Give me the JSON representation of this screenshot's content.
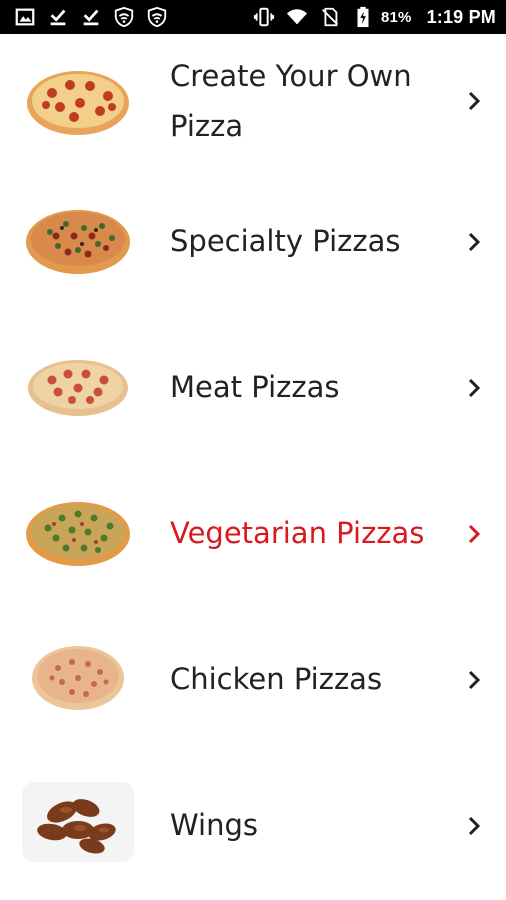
{
  "status_bar": {
    "left_icons": [
      "image-icon",
      "download-done-icon",
      "download-done-icon",
      "shield-wifi-icon",
      "shield-wifi-icon"
    ],
    "right_icons": [
      "vibrate-icon",
      "wifi-icon",
      "no-sim-icon",
      "battery-charging-icon"
    ],
    "battery": "81%",
    "time": "1:19 PM"
  },
  "menu": {
    "active_color": "#d71920",
    "text_color": "#222222",
    "items": [
      {
        "label": "Create Your Own Pizza",
        "image": "pepperoni-pizza-image",
        "active": false
      },
      {
        "label": "Specialty Pizzas",
        "image": "supreme-pizza-image",
        "active": false
      },
      {
        "label": "Meat Pizzas",
        "image": "meat-pizza-image",
        "active": false
      },
      {
        "label": "Vegetarian Pizzas",
        "image": "vegetarian-pizza-image",
        "active": true
      },
      {
        "label": "Chicken Pizzas",
        "image": "chicken-pizza-image",
        "active": false
      },
      {
        "label": "Wings",
        "image": "wings-image",
        "active": false
      }
    ]
  }
}
